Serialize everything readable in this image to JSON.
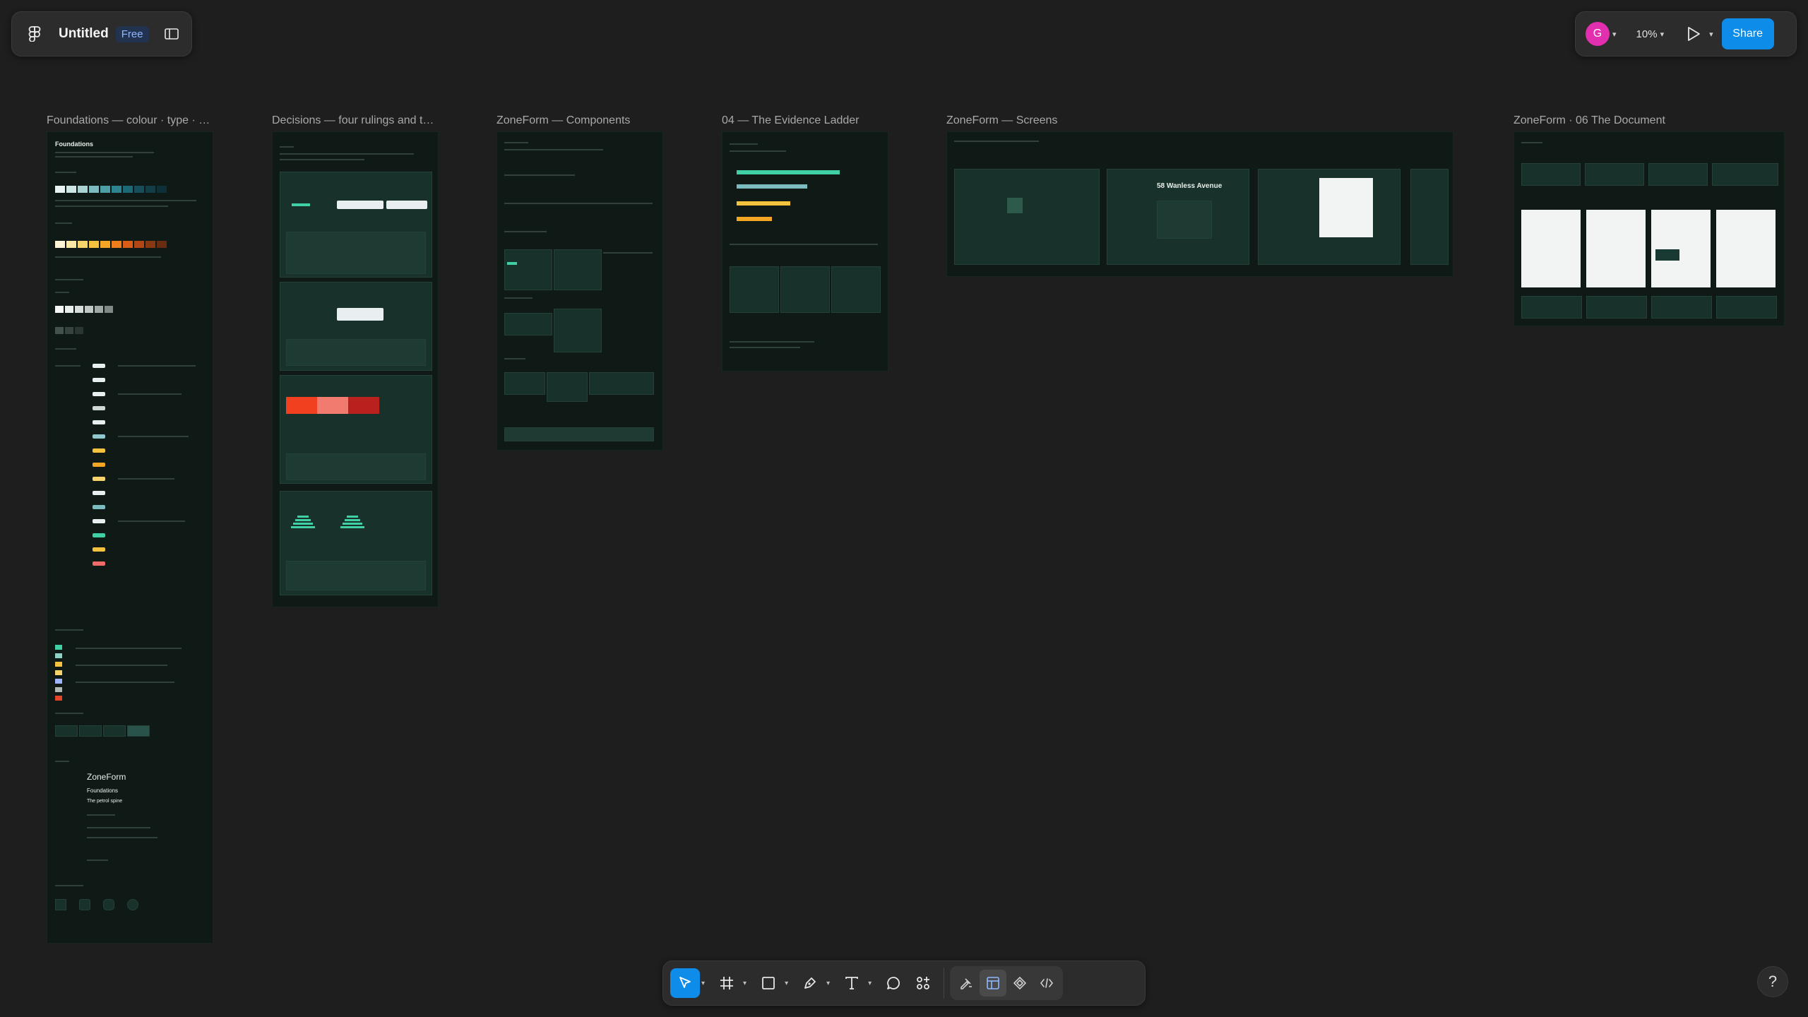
{
  "app": {
    "file_title": "Untitled",
    "plan_badge": "Free"
  },
  "header": {
    "avatar_initial": "G",
    "avatar_color": "#e22fb0",
    "zoom_level": "10%",
    "share_label": "Share",
    "accent": "#0d8ce9"
  },
  "canvas": {
    "frames": [
      {
        "label": "Foundations — colour · type · …"
      },
      {
        "label": "Decisions — four rulings and t…"
      },
      {
        "label": "ZoneForm — Components"
      },
      {
        "label": "04 — The Evidence Ladder"
      },
      {
        "label": "ZoneForm — Screens"
      },
      {
        "label": "ZoneForm · 06 The Document"
      }
    ],
    "foundations": {
      "heading": "Foundations",
      "wordmark": "ZoneForm",
      "sub1": "Foundations",
      "sub2": "The petrol spine"
    },
    "screens": {
      "address": "58 Wanless Avenue"
    }
  },
  "toolbar": {
    "tools": [
      "move-tool",
      "frame-tool",
      "rectangle-tool",
      "pen-tool",
      "text-tool",
      "comment-tool",
      "actions-tool"
    ],
    "modes": [
      "draw-mode",
      "design-mode",
      "prototype-mode",
      "dev-mode"
    ],
    "help_label": "?"
  }
}
